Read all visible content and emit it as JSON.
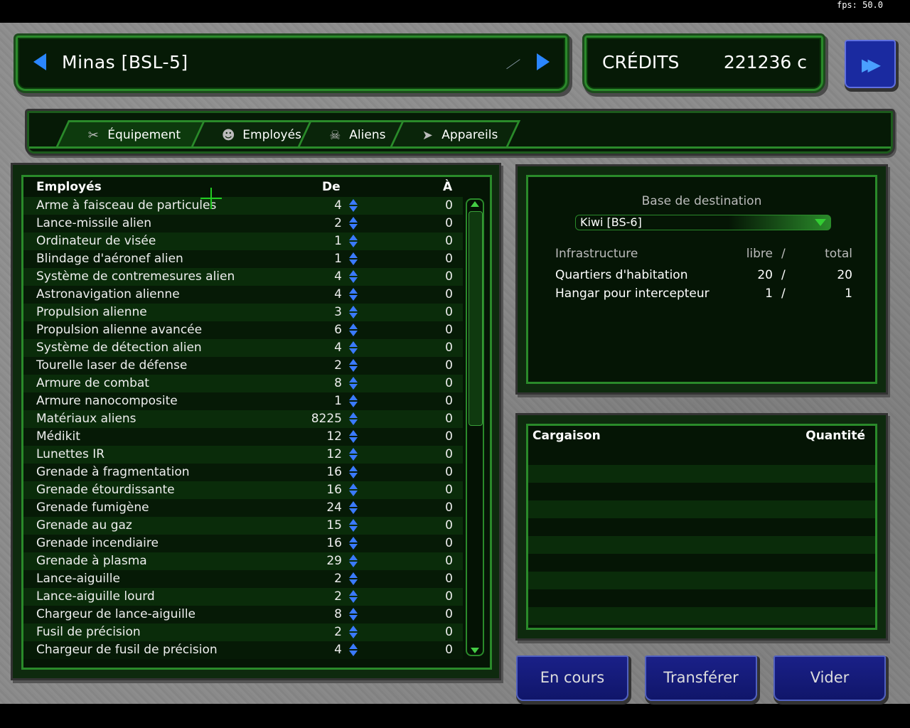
{
  "fps": "fps: 50.0",
  "base": {
    "name": "Minas [BSL-5]"
  },
  "credits": {
    "label": "CRÉDITS",
    "value": "221236 c"
  },
  "tabs": [
    {
      "label": "Équipement",
      "icon": "tools-icon"
    },
    {
      "label": "Employés",
      "icon": "employee-icon"
    },
    {
      "label": "Aliens",
      "icon": "alien-icon"
    },
    {
      "label": "Appareils",
      "icon": "aircraft-icon"
    }
  ],
  "list": {
    "headers": {
      "name": "Employés",
      "from": "De",
      "to": "À"
    },
    "rows": [
      {
        "name": "Arme à faisceau de particules",
        "de": "4",
        "a": "0"
      },
      {
        "name": "Lance-missile alien",
        "de": "2",
        "a": "0"
      },
      {
        "name": "Ordinateur de visée",
        "de": "1",
        "a": "0"
      },
      {
        "name": "Blindage d'aéronef alien",
        "de": "1",
        "a": "0"
      },
      {
        "name": "Système de contremesures alien",
        "de": "4",
        "a": "0"
      },
      {
        "name": "Astronavigation alienne",
        "de": "4",
        "a": "0"
      },
      {
        "name": "Propulsion alienne",
        "de": "3",
        "a": "0"
      },
      {
        "name": "Propulsion alienne avancée",
        "de": "6",
        "a": "0"
      },
      {
        "name": "Système de détection alien",
        "de": "4",
        "a": "0"
      },
      {
        "name": "Tourelle laser de défense",
        "de": "2",
        "a": "0"
      },
      {
        "name": "Armure de combat",
        "de": "8",
        "a": "0"
      },
      {
        "name": "Armure nanocomposite",
        "de": "1",
        "a": "0"
      },
      {
        "name": "Matériaux aliens",
        "de": "8225",
        "a": "0"
      },
      {
        "name": "Médikit",
        "de": "12",
        "a": "0"
      },
      {
        "name": "Lunettes IR",
        "de": "12",
        "a": "0"
      },
      {
        "name": "Grenade à fragmentation",
        "de": "16",
        "a": "0"
      },
      {
        "name": "Grenade étourdissante",
        "de": "16",
        "a": "0"
      },
      {
        "name": "Grenade fumigène",
        "de": "24",
        "a": "0"
      },
      {
        "name": "Grenade au gaz",
        "de": "15",
        "a": "0"
      },
      {
        "name": "Grenade incendiaire",
        "de": "16",
        "a": "0"
      },
      {
        "name": "Grenade à plasma",
        "de": "29",
        "a": "0"
      },
      {
        "name": "Lance-aiguille",
        "de": "2",
        "a": "0"
      },
      {
        "name": "Lance-aiguille lourd",
        "de": "2",
        "a": "0"
      },
      {
        "name": "Chargeur de lance-aiguille",
        "de": "8",
        "a": "0"
      },
      {
        "name": "Fusil de précision",
        "de": "2",
        "a": "0"
      },
      {
        "name": "Chargeur de fusil de précision",
        "de": "4",
        "a": "0"
      }
    ]
  },
  "destination": {
    "label": "Base de destination",
    "selected": "Kiwi [BS-6]",
    "infra_header": {
      "name": "Infrastructure",
      "free": "libre",
      "sep": "/",
      "total": "total"
    },
    "infra_rows": [
      {
        "name": "Quartiers d'habitation",
        "free": "20",
        "sep": "/",
        "total": "20"
      },
      {
        "name": "Hangar pour intercepteur",
        "free": "1",
        "sep": "/",
        "total": "1"
      }
    ]
  },
  "cargo": {
    "col_name": "Cargaison",
    "col_qty": "Quantité"
  },
  "buttons": {
    "in_progress": "En cours",
    "transfer": "Transférer",
    "clear": "Vider"
  }
}
